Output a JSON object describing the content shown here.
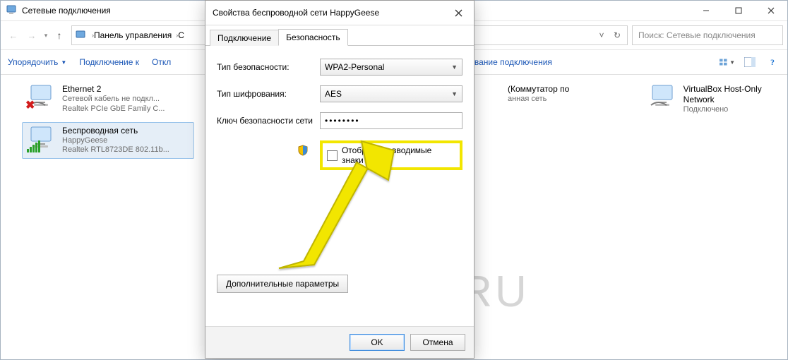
{
  "window": {
    "title": "Сетевые подключения",
    "breadcrumb": [
      "Панель управления",
      "С"
    ],
    "search_placeholder": "Поиск: Сетевые подключения"
  },
  "toolbar": {
    "organize": "Упорядочить",
    "connect_to": "Подключение к",
    "disable": "Откл",
    "rename": "еименование подключения"
  },
  "adapters": [
    {
      "name": "Ethernet 2",
      "status": "Сетевой кабель не подкл...",
      "device": "Realtek PCIe GbE Family C...",
      "disconnected": true
    },
    {
      "name": "Беспроводная сеть",
      "status": "HappyGeese",
      "device": "Realtek RTL8723DE 802.11b...",
      "wifi": true,
      "selected": true
    },
    {
      "name_suffix": "(Коммутатор по",
      "status": "анная сеть",
      "device": ""
    },
    {
      "name": "VirtualBox Host-Only Network",
      "status": "Подключено",
      "device": ""
    }
  ],
  "dialog": {
    "title": "Свойства беспроводной сети HappyGeese",
    "tabs": {
      "connection": "Подключение",
      "security": "Безопасность"
    },
    "labels": {
      "sec_type": "Тип безопасности:",
      "enc_type": "Тип шифрования:",
      "key": "Ключ безопасности сети"
    },
    "values": {
      "sec_type": "WPA2-Personal",
      "enc_type": "AES",
      "key_mask": "••••••••"
    },
    "show_chars": "Отображать вводимые знаки",
    "advanced": "Дополнительные параметры",
    "ok": "OK",
    "cancel": "Отмена"
  },
  "watermark": "KONEKTO.RU"
}
